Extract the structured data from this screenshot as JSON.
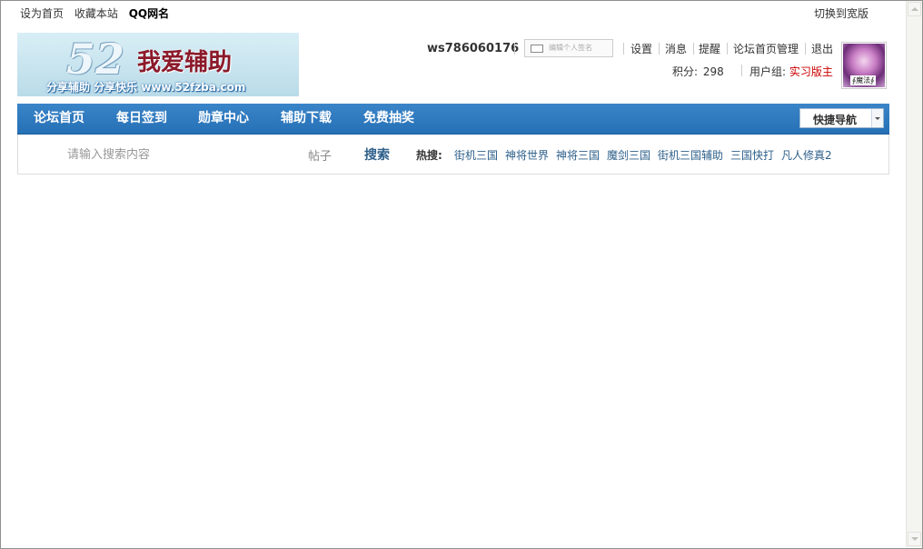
{
  "topbar": {
    "set_homepage": "设为首页",
    "bookmark": "收藏本站",
    "qq_name": "QQ网名",
    "switch_wide": "切换到宽版"
  },
  "logo": {
    "number": "52",
    "name": "我爱辅助",
    "slogan": "分享辅助  分享快乐  www.52fzba.com"
  },
  "user": {
    "username": "ws786060176",
    "status_placeholder": "编辑个人签名",
    "links": [
      "设置",
      "消息",
      "提醒",
      "论坛首页管理",
      "退出"
    ],
    "credits_label": "积分:",
    "credits_value": "298",
    "group_label": "用户组:",
    "group_value": "实习版主",
    "avatar_signature": "∮魔法∮"
  },
  "nav": {
    "items": [
      "论坛首页",
      "每日签到",
      "勋章中心",
      "辅助下载",
      "免费抽奖"
    ],
    "quick_nav": "快捷导航"
  },
  "search": {
    "placeholder": "请输入搜索内容",
    "type": "帖子",
    "button": "搜索",
    "hot_label": "热搜:",
    "hot_terms": [
      "街机三国",
      "神将世界",
      "神将三国",
      "魔剑三国",
      "街机三国辅助",
      "三国快打",
      "凡人修真2"
    ]
  },
  "colors": {
    "nav_blue": "#2670b6",
    "link_blue": "#2d5f8a",
    "rank_red": "#cc0000"
  }
}
